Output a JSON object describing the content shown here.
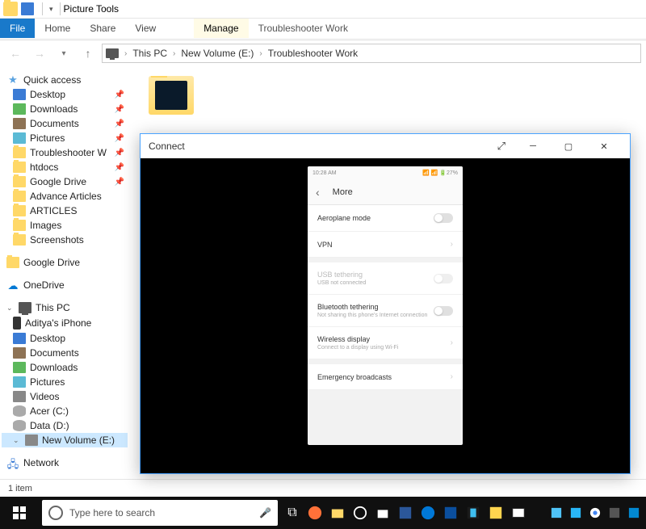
{
  "qat": {
    "context_label": "Picture Tools",
    "window_title": "Troubleshooter Work"
  },
  "ribbon": {
    "file": "File",
    "home": "Home",
    "share": "Share",
    "view": "View",
    "manage": "Manage"
  },
  "breadcrumb": {
    "root": "This PC",
    "drive": "New Volume (E:)",
    "folder": "Troubleshooter Work"
  },
  "sidebar": {
    "quick_access": "Quick access",
    "qa_items": [
      "Desktop",
      "Downloads",
      "Documents",
      "Pictures",
      "Troubleshooter W",
      "htdocs",
      "Google Drive",
      "Advance Articles",
      "ARTICLES",
      "Images",
      "Screenshots"
    ],
    "google_drive": "Google Drive",
    "onedrive": "OneDrive",
    "this_pc": "This PC",
    "pc_items": [
      "Aditya's iPhone",
      "Desktop",
      "Documents",
      "Downloads",
      "Pictures",
      "Videos",
      "Acer (C:)",
      "Data (D:)",
      "New Volume (E:)"
    ],
    "network": "Network"
  },
  "status": {
    "item_count": "1 item"
  },
  "connect": {
    "title": "Connect"
  },
  "phone": {
    "time": "10:28 AM",
    "battery": "27%",
    "header": "More",
    "rows": {
      "aeroplane": "Aeroplane mode",
      "vpn": "VPN",
      "usb_t": "USB tethering",
      "usb_s": "USB not connected",
      "bt_t": "Bluetooth tethering",
      "bt_s": "Not sharing this phone's Internet connection",
      "wd_t": "Wireless display",
      "wd_s": "Connect to a display using Wi-Fi",
      "eb": "Emergency broadcasts"
    }
  },
  "taskbar": {
    "search_placeholder": "Type here to search"
  }
}
